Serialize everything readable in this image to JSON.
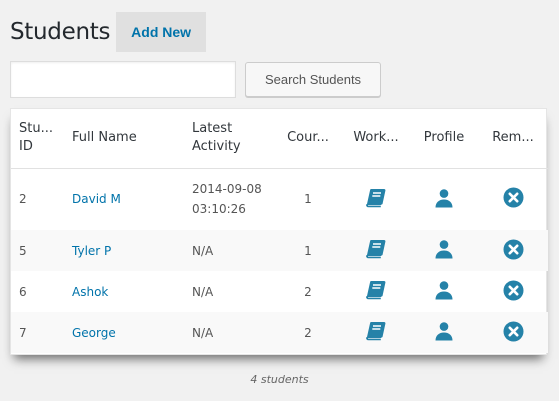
{
  "header": {
    "title": "Students",
    "add_new_label": "Add New"
  },
  "search": {
    "value": "",
    "placeholder": "",
    "button_label": "Search Students"
  },
  "table": {
    "columns": [
      "Stu... ID",
      "Full Name",
      "Latest Activity",
      "Cour...",
      "Work...",
      "Profile",
      "Rem..."
    ],
    "col_id_line1": "Stu...",
    "col_id_line2": "ID",
    "col_activity_line1": "Latest",
    "col_activity_line2": "Activity",
    "rows": [
      {
        "id": "2",
        "name": "David M",
        "activity_date": "2014-09-08",
        "activity_time": "03:10:26",
        "courses": "1"
      },
      {
        "id": "5",
        "name": "Tyler P",
        "activity_date": "N/A",
        "activity_time": "",
        "courses": "1"
      },
      {
        "id": "6",
        "name": "Ashok",
        "activity_date": "N/A",
        "activity_time": "",
        "courses": "2"
      },
      {
        "id": "7",
        "name": "George",
        "activity_date": "N/A",
        "activity_time": "",
        "courses": "2"
      }
    ]
  },
  "footer": {
    "count_label": "4 students"
  },
  "colors": {
    "accent": "#0073aa",
    "icon": "#2582a8"
  },
  "icons": {
    "work": "book-icon",
    "profile": "user-icon",
    "remove": "remove-circle-icon"
  }
}
